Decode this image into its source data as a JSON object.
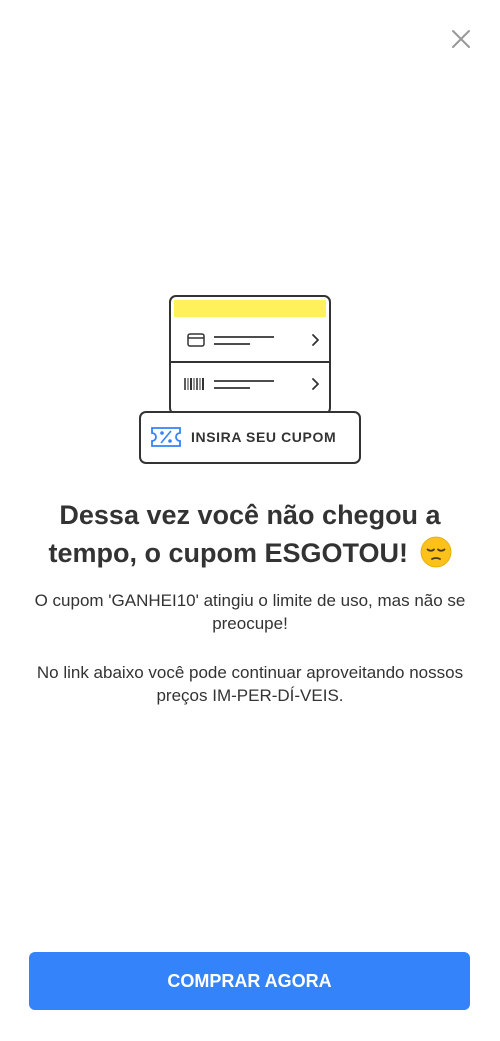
{
  "header": {
    "close_icon": "close-icon"
  },
  "illustration": {
    "coupon_label": "INSIRA SEU CUPOM",
    "accent_color": "#fff159",
    "icons": [
      "credit-card-icon",
      "barcode-icon",
      "chevron-right-icon",
      "coupon-percent-icon"
    ]
  },
  "message": {
    "headline_line1": "Dessa vez você não chegou a",
    "headline_line2": "tempo, o cupom ESGOTOU!",
    "emoji": "pensive-face-emoji",
    "paragraph1": "O cupom 'GANHEI10' atingiu o limite de uso, mas não se preocupe!",
    "paragraph2": "No link abaixo você pode continuar aproveitando nossos preços IM-PER-DÍ-VEIS."
  },
  "cta": {
    "label": "COMPRAR AGORA",
    "color": "#3483fa"
  }
}
